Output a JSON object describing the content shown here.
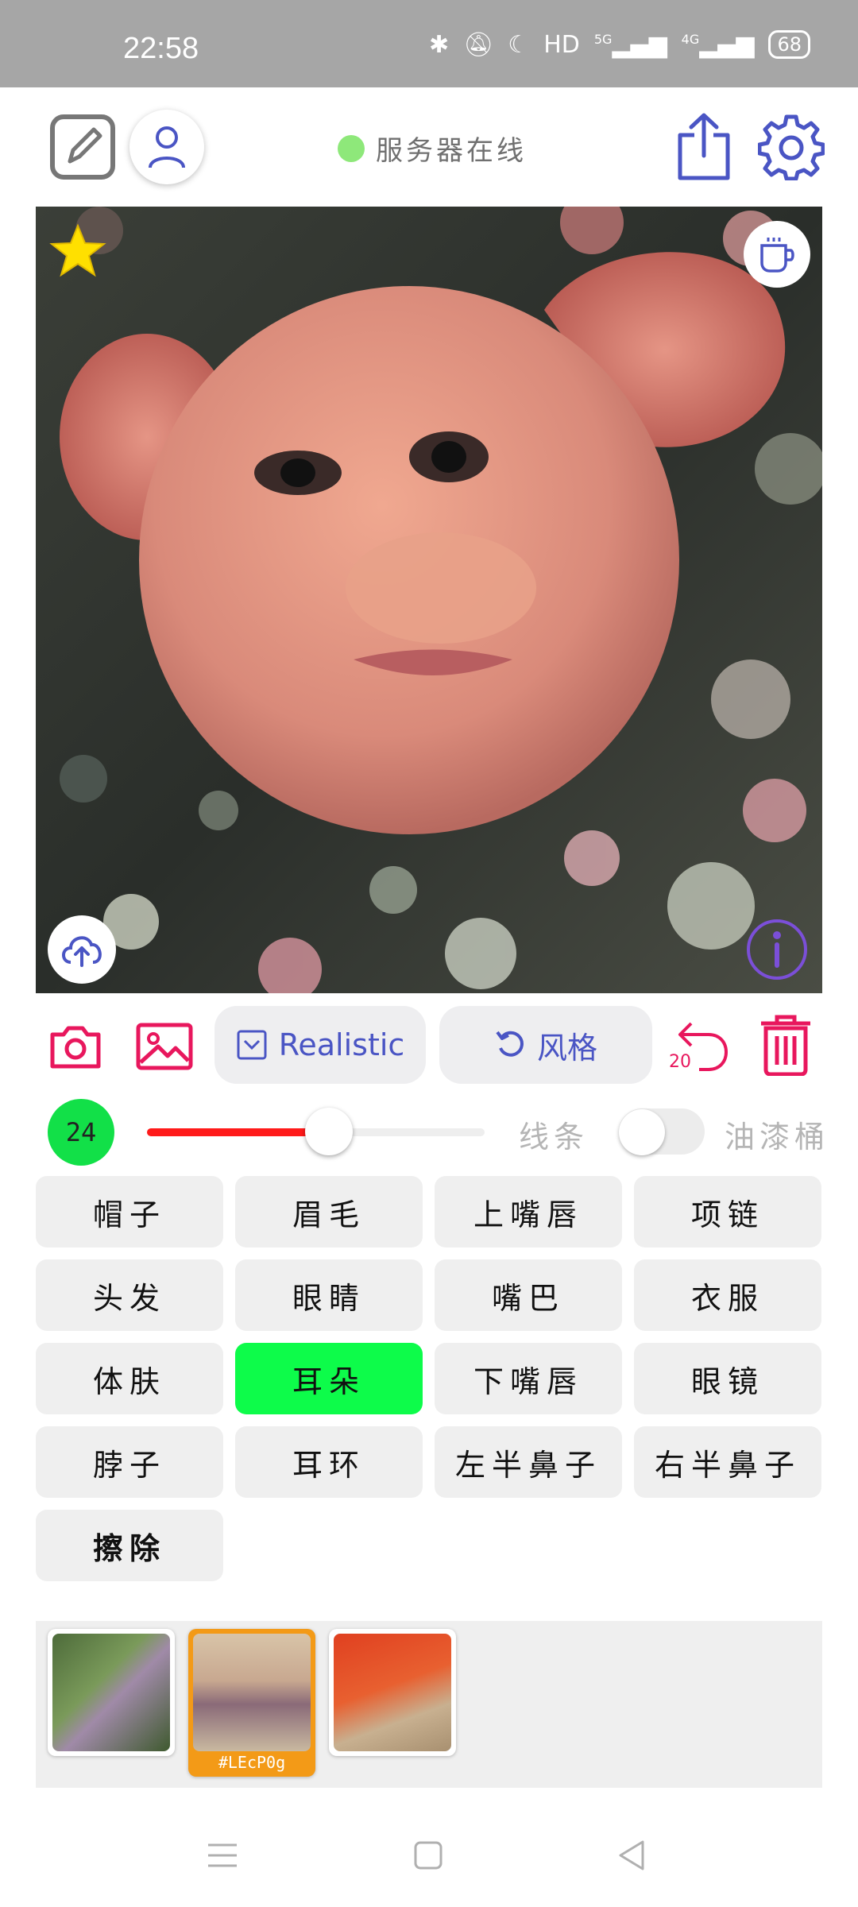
{
  "status_bar": {
    "time": "22:58",
    "bluetooth_icon": "bluetooth-icon",
    "network_label": "HD",
    "signal_1": "5G",
    "signal_2": "4G",
    "battery": "68"
  },
  "top_bar": {
    "server_status": "服务器在线",
    "server_status_color": "#8ee87a",
    "edit_icon": "edit-square-icon",
    "user_icon": "user-icon",
    "share_icon": "share-icon",
    "settings_icon": "gear-icon"
  },
  "canvas": {
    "favorite_icon": "star-icon",
    "coffee_icon": "coffee-icon",
    "upload_icon": "cloud-upload-icon",
    "info_icon": "info-icon"
  },
  "toolbar": {
    "style_label": "Realistic",
    "restyle_label": "风格",
    "undo_count": "20",
    "accent_color": "#e8175d",
    "primary_color": "#4a55c4"
  },
  "brush": {
    "size": "24",
    "slider_fraction": 0.49,
    "lines_label": "线条",
    "bucket_label": "油漆桶",
    "bucket_enabled": false
  },
  "parts": {
    "hat": "帽子",
    "eyebrows": "眉毛",
    "upper_lip": "上嘴唇",
    "necklace": "项链",
    "hair": "头发",
    "eyes": "眼睛",
    "mouth": "嘴巴",
    "clothes": "衣服",
    "skin": "体肤",
    "ears": "耳朵",
    "lower_lip": "下嘴唇",
    "glasses": "眼镜",
    "neck": "脖子",
    "earrings": "耳环",
    "left_nose": "左半鼻子",
    "right_nose": "右半鼻子",
    "erase": "擦除",
    "selected": "耳朵",
    "selected_color": "#0dfc4a"
  },
  "history": {
    "active_code": "#LEcP0g"
  }
}
